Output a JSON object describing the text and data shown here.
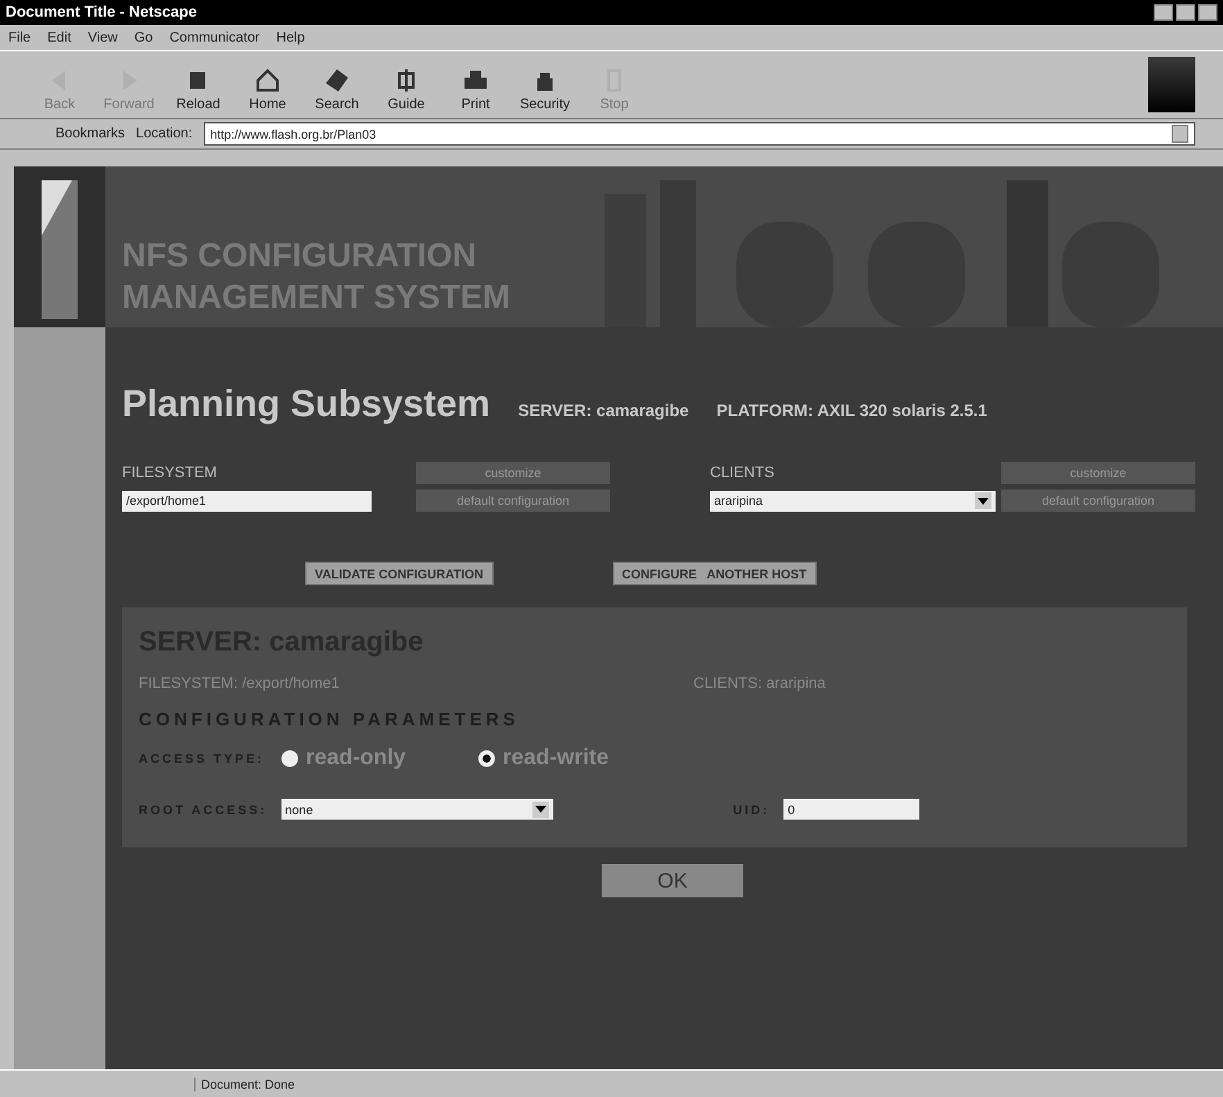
{
  "window": {
    "title": "Document Title - Netscape"
  },
  "menu": [
    "File",
    "Edit",
    "View",
    "Go",
    "Communicator",
    "Help"
  ],
  "toolbar": [
    {
      "label": "Back",
      "kind": "back",
      "disabled": true
    },
    {
      "label": "Forward",
      "kind": "forward",
      "disabled": true
    },
    {
      "label": "Reload",
      "kind": "reload",
      "disabled": false
    },
    {
      "label": "Home",
      "kind": "home",
      "disabled": false
    },
    {
      "label": "Search",
      "kind": "search",
      "disabled": false
    },
    {
      "label": "Guide",
      "kind": "guide",
      "disabled": false
    },
    {
      "label": "Print",
      "kind": "print",
      "disabled": false
    },
    {
      "label": "Security",
      "kind": "security",
      "disabled": false
    },
    {
      "label": "Stop",
      "kind": "stop",
      "disabled": true
    }
  ],
  "location_bar": {
    "bookmarks": "Bookmarks",
    "location_label": "Location:",
    "url": "http://www.flash.org.br/Plan03"
  },
  "page": {
    "header": [
      "NFS CONFIGURATION",
      "MANAGEMENT SYSTEM"
    ],
    "title": "Planning Subsystem",
    "server": "SERVER: camaragibe",
    "platform": "PLATFORM: AXIL 320  solaris 2.5.1",
    "filesystem": {
      "label": "FILESYSTEM",
      "value": "/export/home1",
      "customize": "customize",
      "default": "default configuration"
    },
    "clients": {
      "label": "CLIENTS",
      "value": "araripina",
      "customize": "customize",
      "default": "default configuration"
    },
    "actions": [
      "VALIDATE CONFIGURATION",
      "CONFIGURE   ANOTHER HOST"
    ],
    "summary": {
      "server": "SERVER: camaragibe",
      "filesystem": "FILESYSTEM: /export/home1",
      "clients": "CLIENTS: araripina",
      "heading": "CONFIGURATION PARAMETERS",
      "access_label": "ACCESS TYPE:",
      "access": [
        {
          "label": "read-only",
          "selected": false
        },
        {
          "label": "read-write",
          "selected": true
        }
      ],
      "root_label": "ROOT ACCESS:",
      "root_value": "none",
      "uid_label": "UID:",
      "uid_value": "0"
    },
    "ok": "OK"
  },
  "status_bar": {
    "text": "Document: Done"
  }
}
